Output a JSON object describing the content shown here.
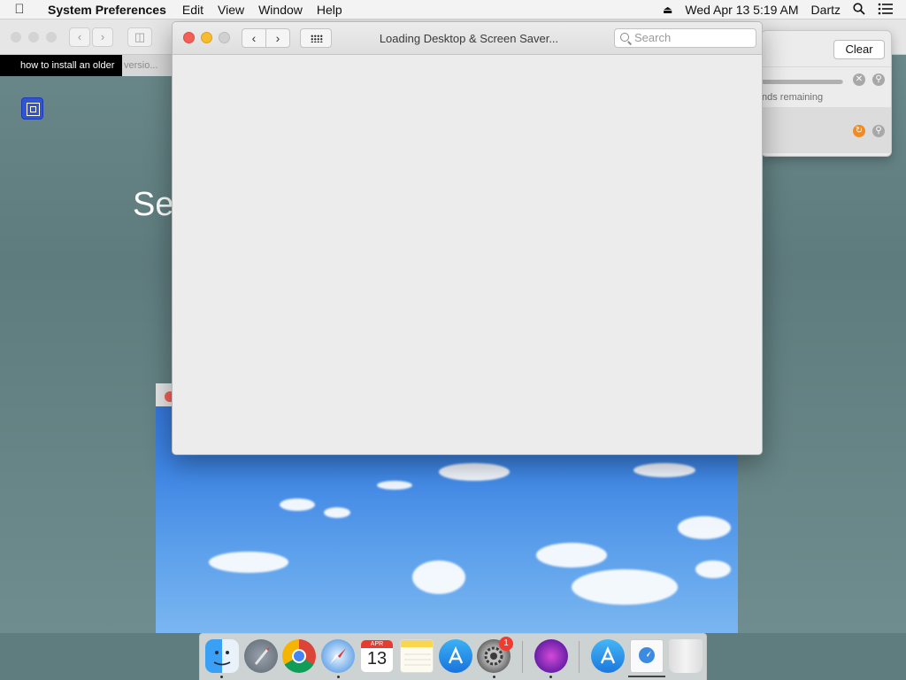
{
  "menubar": {
    "app_name": "System Preferences",
    "menus": [
      "Edit",
      "View",
      "Window",
      "Help"
    ],
    "datetime": "Wed Apr 13  5:19 AM",
    "user": "Dartz"
  },
  "browser": {
    "tab_active": "how to install an older",
    "tab_rest": "versio...",
    "hero_text": "Se"
  },
  "downloads": {
    "clear_label": "Clear",
    "status_text": "nds remaining",
    "progress": 0.99
  },
  "sysprefs": {
    "title": "Loading Desktop & Screen Saver...",
    "search_placeholder": "Search"
  },
  "dock": {
    "calendar_month": "APR",
    "calendar_day": "13",
    "sysprefs_badge": "1",
    "apps": [
      "Finder",
      "Launchpad",
      "Chrome",
      "Safari",
      "Calendar",
      "Notes",
      "App Store",
      "System Preferences",
      "Siri",
      "Xcode Installer",
      "Safari Download",
      "Trash"
    ]
  },
  "colors": {
    "close": "#f25f57",
    "minimize": "#f7bc2e",
    "zoom_disabled": "#d0d0d0",
    "wallpaper": "#3f86e4"
  }
}
